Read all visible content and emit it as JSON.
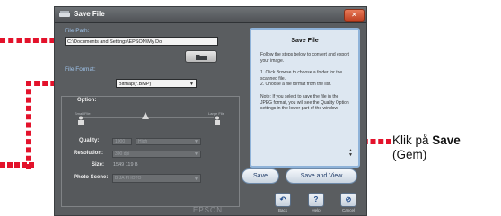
{
  "window": {
    "title": "Save File",
    "close_label": "✕"
  },
  "file_path": {
    "label": "File Path:",
    "value": "C:\\Documents and Settings\\EPSON\\My Do"
  },
  "file_format": {
    "label": "File Format:",
    "value": "Bitmap(*.BMP)"
  },
  "option": {
    "title": "Option:",
    "small_file_label": "Small File",
    "large_file_label": "Large File",
    "quality_label": "Quality:",
    "quality_value": "1000",
    "quality_select": "High",
    "resolution_label": "Resolution:",
    "resolution_value": "300 dpi",
    "size_label": "Size:",
    "size_value": "1549 119 B",
    "photo_scene_label": "Photo Scene:",
    "photo_scene_value": "B  JA PHOTO"
  },
  "help_panel": {
    "title": "Save File",
    "intro": "Follow the steps below to convert and export your image.",
    "steps": "1. Click Browse to choose a folder for the scanned file.\n2. Choose a file format from the list.",
    "note": "Note: If you select to save the file in the JPEG format, you will see the Quality Option settings in the lower part of the window."
  },
  "buttons": {
    "save": "Save",
    "save_and_view": "Save and View",
    "back": "Back",
    "help": "Help",
    "cancel": "Cancel"
  },
  "brand": "EPSON",
  "callout": {
    "prefix": "Klik på ",
    "bold": "Save",
    "line2": "(Gem)"
  },
  "colors": {
    "annotation_red": "#e3122b",
    "window_bg": "#5a5d60",
    "panel_bg": "#dde7f1"
  }
}
